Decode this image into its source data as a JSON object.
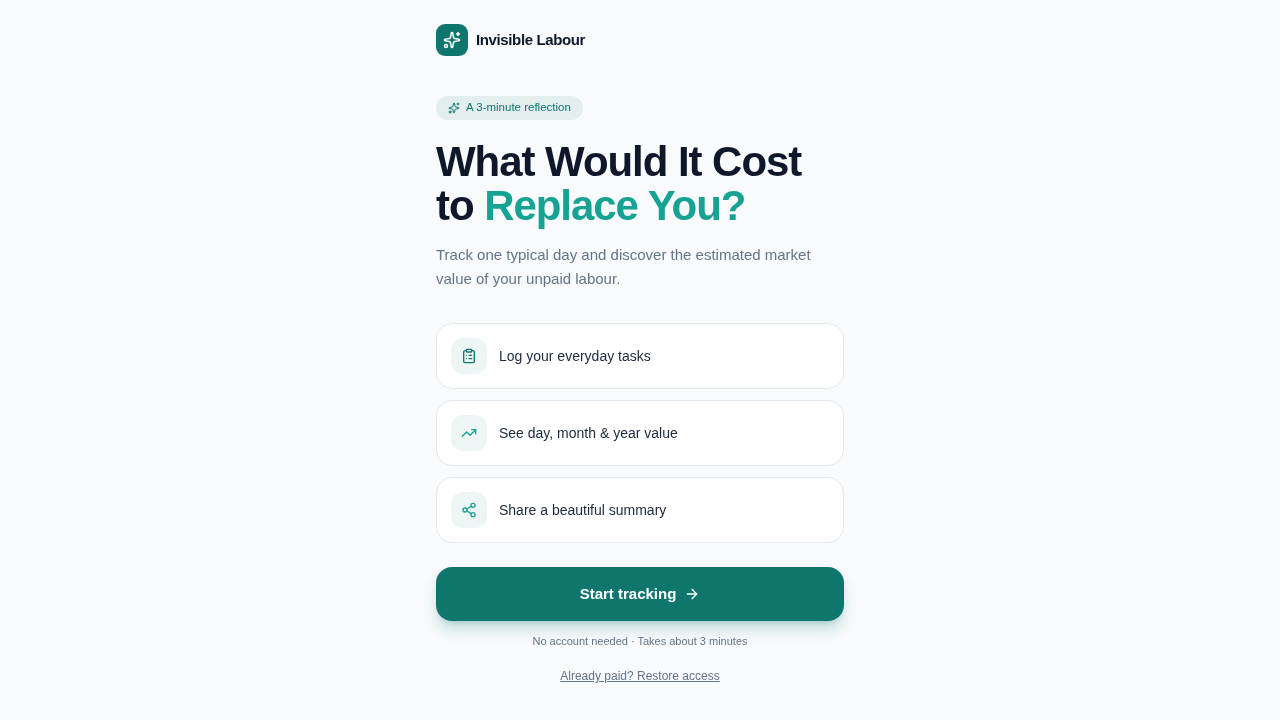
{
  "brand": {
    "name": "Invisible Labour"
  },
  "badge": {
    "label": "A 3-minute reflection"
  },
  "heading": {
    "text": "What Would It Cost to",
    "highlight": "Replace You?"
  },
  "subtitle": "Track one typical day and discover the estimated market value of your unpaid labour.",
  "features": [
    {
      "label": "Log your everyday tasks"
    },
    {
      "label": "See day, month & year value"
    },
    {
      "label": "Share a beautiful summary"
    }
  ],
  "primary_button": {
    "label": "Start tracking"
  },
  "note": "No account needed · Takes about 3 minutes",
  "restore_link": {
    "label": "Already paid? Restore access"
  }
}
